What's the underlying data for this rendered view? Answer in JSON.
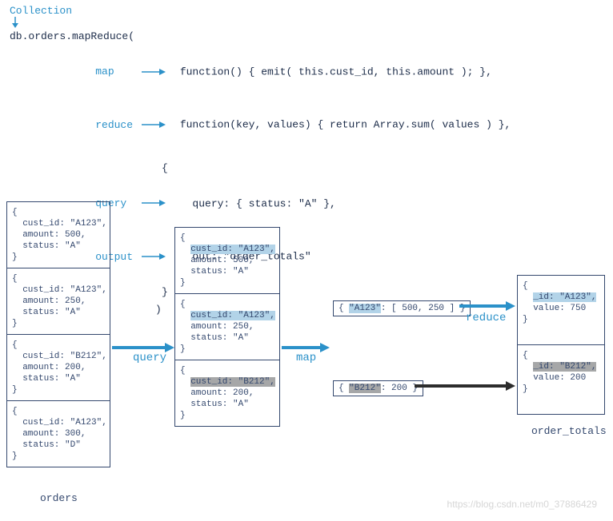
{
  "code": {
    "collection_label": "Collection",
    "line1": "db.orders.mapReduce(",
    "map_label": "map",
    "map_fn": "function() { emit( this.cust_id, this.amount ); },",
    "reduce_label": "reduce",
    "reduce_fn": "function(key, values) { return Array.sum( values ) },",
    "open_brace": "{",
    "query_label": "query",
    "query_line": "  query: { status: \"A\" },",
    "output_label": "output",
    "output_line": "  out: \"order_totals\"",
    "close_brace": "}",
    "close_paren": ")"
  },
  "orders": {
    "label": "orders",
    "docs": [
      {
        "cust": "cust_id: \"A123\",",
        "amount": "amount: 500,",
        "status": "status: \"A\""
      },
      {
        "cust": "cust_id: \"A123\",",
        "amount": "amount: 250,",
        "status": "status: \"A\""
      },
      {
        "cust": "cust_id: \"B212\",",
        "amount": "amount: 200,",
        "status": "status: \"A\""
      },
      {
        "cust": "cust_id: \"A123\",",
        "amount": "amount: 300,",
        "status": "status: \"D\""
      }
    ]
  },
  "filtered": {
    "docs": [
      {
        "cust": "cust_id: \"A123\",",
        "amount": "amount: 500,",
        "status": "status: \"A\"",
        "hl": "blue"
      },
      {
        "cust": "cust_id: \"A123\",",
        "amount": "amount: 250,",
        "status": "status: \"A\"",
        "hl": "blue"
      },
      {
        "cust": "cust_id: \"B212\",",
        "amount": "amount: 200,",
        "status": "status: \"A\"",
        "hl": "gray"
      }
    ]
  },
  "mapped": {
    "a123": "{ \"A123\": [ 500, 250 ] }",
    "b212": "{ \"B212\": 200 }",
    "a123_key": "\"A123\"",
    "b212_key": "\"B212\""
  },
  "results": {
    "label": "order_totals",
    "docs": [
      {
        "id": "_id: \"A123\",",
        "value": "value: 750"
      },
      {
        "id": "_id: \"B212\",",
        "value": "value: 200"
      }
    ]
  },
  "stages": {
    "query": "query",
    "map": "map",
    "reduce": "reduce"
  },
  "watermark": "https://blog.csdn.net/m0_37886429"
}
